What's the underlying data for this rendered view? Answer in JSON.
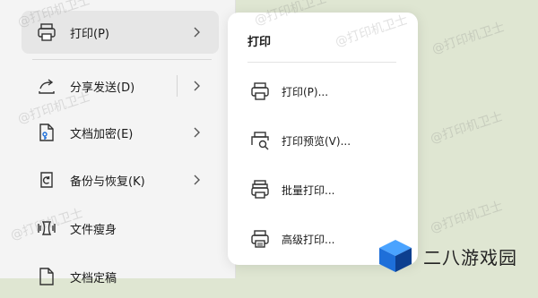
{
  "menu": {
    "items": [
      {
        "label": "打印(P)",
        "icon": "printer-icon",
        "chevron": true
      },
      {
        "label": "分享发送(D)",
        "icon": "share-icon",
        "chevron": true
      },
      {
        "label": "文档加密(E)",
        "icon": "document-key-icon",
        "chevron": true
      },
      {
        "label": "备份与恢复(K)",
        "icon": "backup-restore-icon",
        "chevron": true
      },
      {
        "label": "文件瘦身",
        "icon": "file-slim-icon",
        "chevron": false
      },
      {
        "label": "文档定稿",
        "icon": "document-finalize-icon",
        "chevron": false
      }
    ]
  },
  "submenu": {
    "title": "打印",
    "items": [
      {
        "label": "打印(P)...",
        "icon": "printer-icon"
      },
      {
        "label": "打印预览(V)...",
        "icon": "print-preview-icon"
      },
      {
        "label": "批量打印...",
        "icon": "batch-print-icon"
      },
      {
        "label": "高级打印...",
        "icon": "advanced-print-icon"
      }
    ]
  },
  "watermark": "@打印机卫士",
  "brand": {
    "name": "二八游戏园"
  },
  "colors": {
    "background": "#dfe6d2",
    "menu_bg": "#f4f4f4",
    "active": "#e6e6e6",
    "logo_blue": "#1e6fd9"
  }
}
